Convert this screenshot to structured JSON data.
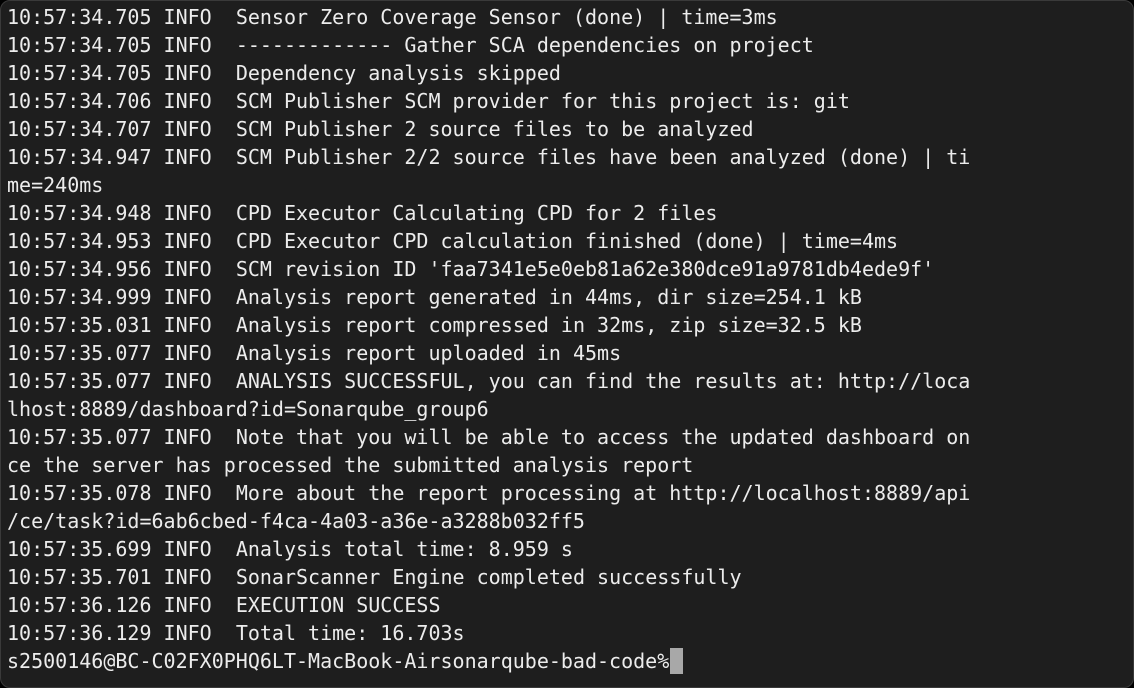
{
  "terminal": {
    "lines": [
      {
        "time": "10:57:34.705",
        "level": "INFO",
        "message": "Sensor Zero Coverage Sensor (done) | time=3ms"
      },
      {
        "time": "10:57:34.705",
        "level": "INFO",
        "message": "------------- Gather SCA dependencies on project"
      },
      {
        "time": "10:57:34.705",
        "level": "INFO",
        "message": "Dependency analysis skipped"
      },
      {
        "time": "10:57:34.706",
        "level": "INFO",
        "message": "SCM Publisher SCM provider for this project is: git"
      },
      {
        "time": "10:57:34.707",
        "level": "INFO",
        "message": "SCM Publisher 2 source files to be analyzed"
      },
      {
        "time": "10:57:34.947",
        "level": "INFO",
        "message": "SCM Publisher 2/2 source files have been analyzed (done) | ti",
        "continuation": "me=240ms"
      },
      {
        "time": "10:57:34.948",
        "level": "INFO",
        "message": "CPD Executor Calculating CPD for 2 files"
      },
      {
        "time": "10:57:34.953",
        "level": "INFO",
        "message": "CPD Executor CPD calculation finished (done) | time=4ms"
      },
      {
        "time": "10:57:34.956",
        "level": "INFO",
        "message": "SCM revision ID 'faa7341e5e0eb81a62e380dce91a9781db4ede9f'"
      },
      {
        "time": "10:57:34.999",
        "level": "INFO",
        "message": "Analysis report generated in 44ms, dir size=254.1 kB"
      },
      {
        "time": "10:57:35.031",
        "level": "INFO",
        "message": "Analysis report compressed in 32ms, zip size=32.5 kB"
      },
      {
        "time": "10:57:35.077",
        "level": "INFO",
        "message": "Analysis report uploaded in 45ms"
      },
      {
        "time": "10:57:35.077",
        "level": "INFO",
        "message": "ANALYSIS SUCCESSFUL, you can find the results at: http://loca",
        "continuation": "lhost:8889/dashboard?id=Sonarqube_group6"
      },
      {
        "time": "10:57:35.077",
        "level": "INFO",
        "message": "Note that you will be able to access the updated dashboard on",
        "continuation": "ce the server has processed the submitted analysis report"
      },
      {
        "time": "10:57:35.078",
        "level": "INFO",
        "message": "More about the report processing at http://localhost:8889/api",
        "continuation": "/ce/task?id=6ab6cbed-f4ca-4a03-a36e-a3288b032ff5"
      },
      {
        "time": "10:57:35.699",
        "level": "INFO",
        "message": "Analysis total time: 8.959 s"
      },
      {
        "time": "10:57:35.701",
        "level": "INFO",
        "message": "SonarScanner Engine completed successfully"
      },
      {
        "time": "10:57:36.126",
        "level": "INFO",
        "message": "EXECUTION SUCCESS"
      },
      {
        "time": "10:57:36.129",
        "level": "INFO",
        "message": "Total time: 16.703s"
      }
    ],
    "prompt": {
      "user_host": "s2500146@BC-C02FX0PHQ6LT-MacBook-Air",
      "directory": "sonarqube-bad-code",
      "symbol": "%"
    },
    "colors": {
      "background": "#1e1e1e",
      "foreground": "#ececec",
      "cursor": "#a8a8a8"
    }
  }
}
